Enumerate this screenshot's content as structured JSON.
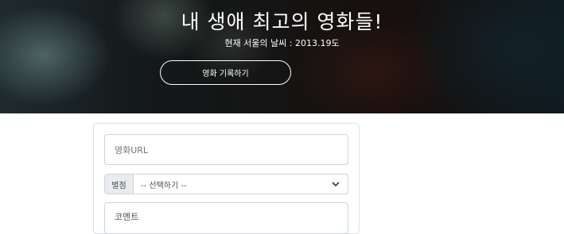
{
  "hero": {
    "title": "내 생애 최고의 영화들!",
    "weather": "현재 서울의 날씨 : 2013.19도",
    "record_button": "영화 기록하기"
  },
  "form": {
    "url_placeholder": "영화URL",
    "star_label": "별점",
    "star_select_value": "-- 선택하기 --",
    "comment_placeholder": "코멘트"
  },
  "icons": {
    "select_arrow": "chevron-down-icon"
  },
  "colors": {
    "hero_text": "#ffffff",
    "input_border": "#ced4da",
    "addon_background": "#e9ecef"
  }
}
